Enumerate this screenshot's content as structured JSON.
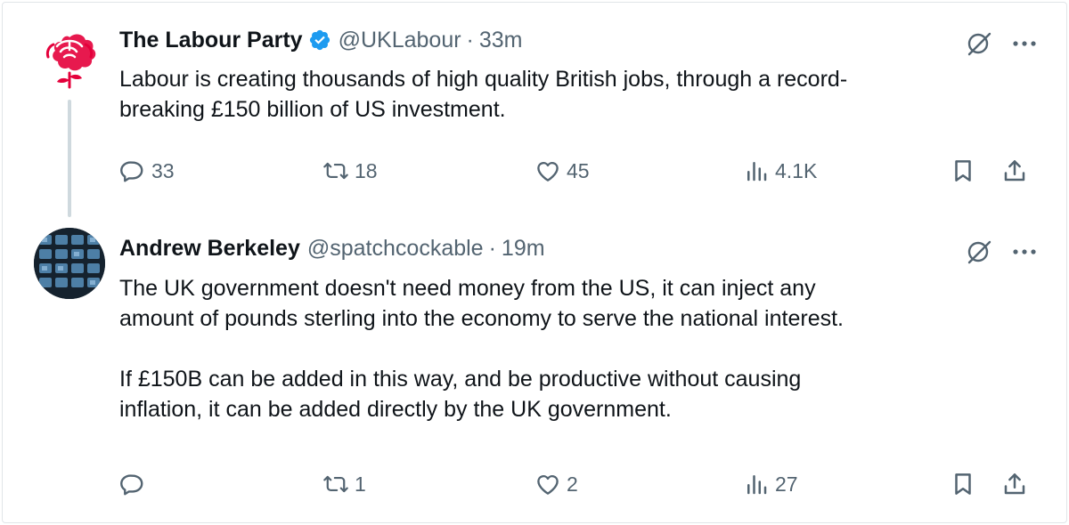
{
  "tweets": [
    {
      "name": "The Labour Party",
      "verified": true,
      "handle": "@UKLabour",
      "separator": "·",
      "time": "33m",
      "avatar_icon": "labour-rose-logo",
      "text_lines": [
        "Labour is creating thousands of high quality British jobs, through a record-",
        "breaking £150 billion of US investment."
      ],
      "replies": "33",
      "retweets": "18",
      "likes": "45",
      "views": "4.1K"
    },
    {
      "name": "Andrew Berkeley",
      "verified": false,
      "handle": "@spatchcockable",
      "separator": "·",
      "time": "19m",
      "avatar_icon": "grid-of-screens-photo",
      "text_lines": [
        "The UK government doesn't need money from the US, it can inject any",
        "amount of pounds sterling into the economy to serve the national interest.",
        "",
        "If £150B can be added in this way, and be productive without causing",
        "inflation, it can be added directly by the UK government."
      ],
      "replies": "",
      "retweets": "1",
      "likes": "2",
      "views": "27"
    }
  ],
  "icons": {
    "grok": "grok-icon",
    "more": "more-icon",
    "reply": "reply-icon",
    "retweet": "retweet-icon",
    "like": "heart-icon",
    "views": "views-icon",
    "bookmark": "bookmark-icon",
    "share": "share-icon",
    "verified": "verified-badge-icon"
  },
  "colors": {
    "text": "#0f1419",
    "secondary": "#536471",
    "verified": "#1d9bf0",
    "labour_red": "#e4003b"
  }
}
